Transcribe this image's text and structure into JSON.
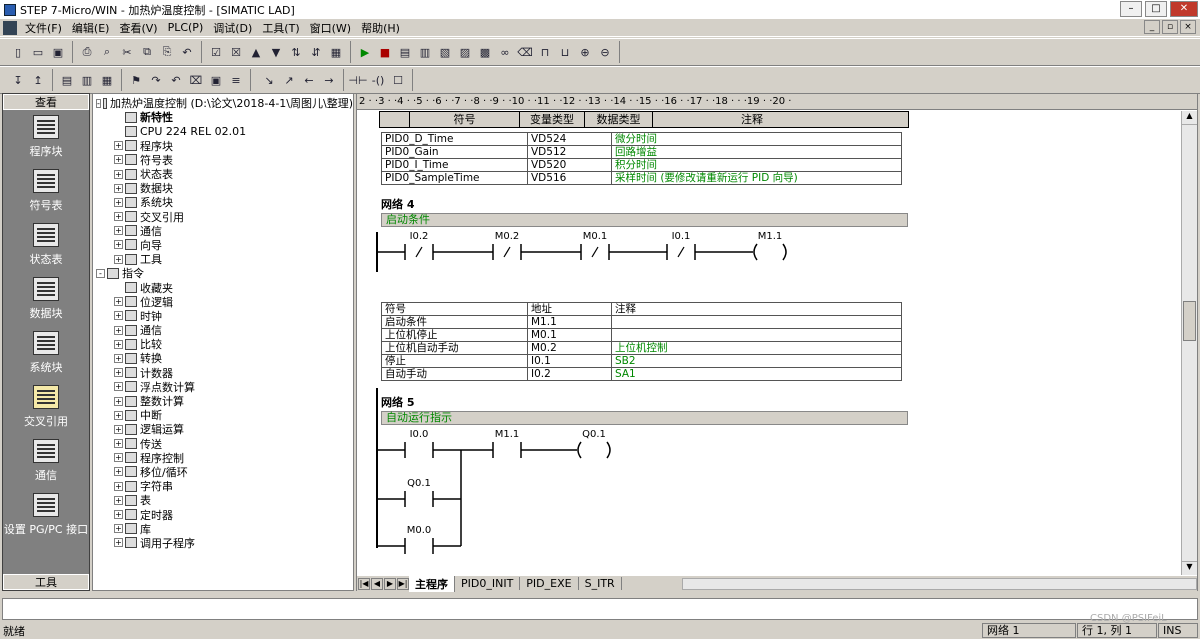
{
  "window": {
    "title": "STEP 7-Micro/WIN - 加热炉温度控制 - [SIMATIC LAD]"
  },
  "menu": [
    "文件(F)",
    "编辑(E)",
    "查看(V)",
    "PLC(P)",
    "调试(D)",
    "工具(T)",
    "窗口(W)",
    "帮助(H)"
  ],
  "nav": {
    "header": "查看",
    "footer": "工具",
    "items": [
      "程序块",
      "符号表",
      "状态表",
      "数据块",
      "系统块",
      "交叉引用",
      "通信",
      "设置 PG/PC 接口"
    ]
  },
  "tree": [
    {
      "label": "加热炉温度控制 (D:\\论文\\2018-4-1\\周图儿\\整理)",
      "level": 0,
      "pm": "-"
    },
    {
      "label": "新特性",
      "level": 1,
      "pm": "",
      "bold": true
    },
    {
      "label": "CPU 224 REL 02.01",
      "level": 1,
      "pm": ""
    },
    {
      "label": "程序块",
      "level": 1,
      "pm": "+"
    },
    {
      "label": "符号表",
      "level": 1,
      "pm": "+"
    },
    {
      "label": "状态表",
      "level": 1,
      "pm": "+"
    },
    {
      "label": "数据块",
      "level": 1,
      "pm": "+"
    },
    {
      "label": "系统块",
      "level": 1,
      "pm": "+"
    },
    {
      "label": "交叉引用",
      "level": 1,
      "pm": "+"
    },
    {
      "label": "通信",
      "level": 1,
      "pm": "+"
    },
    {
      "label": "向导",
      "level": 1,
      "pm": "+"
    },
    {
      "label": "工具",
      "level": 1,
      "pm": "+"
    },
    {
      "label": "指令",
      "level": 0,
      "pm": "-"
    },
    {
      "label": "收藏夹",
      "level": 1,
      "pm": ""
    },
    {
      "label": "位逻辑",
      "level": 1,
      "pm": "+"
    },
    {
      "label": "时钟",
      "level": 1,
      "pm": "+"
    },
    {
      "label": "通信",
      "level": 1,
      "pm": "+"
    },
    {
      "label": "比较",
      "level": 1,
      "pm": "+"
    },
    {
      "label": "转换",
      "level": 1,
      "pm": "+"
    },
    {
      "label": "计数器",
      "level": 1,
      "pm": "+"
    },
    {
      "label": "浮点数计算",
      "level": 1,
      "pm": "+"
    },
    {
      "label": "整数计算",
      "level": 1,
      "pm": "+"
    },
    {
      "label": "中断",
      "level": 1,
      "pm": "+"
    },
    {
      "label": "逻辑运算",
      "level": 1,
      "pm": "+"
    },
    {
      "label": "传送",
      "level": 1,
      "pm": "+"
    },
    {
      "label": "程序控制",
      "level": 1,
      "pm": "+"
    },
    {
      "label": "移位/循环",
      "level": 1,
      "pm": "+"
    },
    {
      "label": "字符串",
      "level": 1,
      "pm": "+"
    },
    {
      "label": "表",
      "level": 1,
      "pm": "+"
    },
    {
      "label": "定时器",
      "level": 1,
      "pm": "+"
    },
    {
      "label": "库",
      "level": 1,
      "pm": "+"
    },
    {
      "label": "调用子程序",
      "level": 1,
      "pm": "+"
    }
  ],
  "ruler": "2 · ·3 · ·4 · ·5 · ·6 · ·7 · ·8 · ·9 · ·10 · ·11 · ·12 · ·13 · ·14 · ·15 · ·16 · ·17 · ·18 · · ·19 · ·20 ·",
  "symhead": [
    "符号",
    "变量类型",
    "数据类型",
    "注释"
  ],
  "pidTable": [
    [
      "PID0_D_Time",
      "VD524",
      "微分时间"
    ],
    [
      "PID0_Gain",
      "VD512",
      "回路增益"
    ],
    [
      "PID0_I_Time",
      "VD520",
      "积分时间"
    ],
    [
      "PID0_SampleTime",
      "VD516",
      "采样时间 (要修改请重新运行 PID 向导)"
    ]
  ],
  "net4": {
    "label": "网络 4",
    "comment": "启动条件",
    "contacts": [
      "I0.2",
      "M0.2",
      "M0.1",
      "I0.1"
    ],
    "coil": "M1.1",
    "symTable": {
      "head": [
        "符号",
        "地址",
        "注释"
      ],
      "rows": [
        [
          "启动条件",
          "M1.1",
          ""
        ],
        [
          "上位机停止",
          "M0.1",
          ""
        ],
        [
          "上位机自动手动",
          "M0.2",
          "上位机控制"
        ],
        [
          "停止",
          "I0.1",
          "SB2"
        ],
        [
          "自动手动",
          "I0.2",
          "SA1"
        ]
      ]
    }
  },
  "net5": {
    "label": "网络 5",
    "comment": "自动运行指示",
    "contacts": [
      "I0.0",
      "M1.1",
      "Q0.1",
      "M0.0"
    ],
    "coil": "Q0.1"
  },
  "tabs": [
    "主程序",
    "PID0_INIT",
    "PID_EXE",
    "S_ITR"
  ],
  "status": {
    "ready": "就绪",
    "network": "网络 1",
    "position": "行 1, 列 1",
    "mode": "INS",
    "watermark": "CSDN @PSIFeiL"
  }
}
